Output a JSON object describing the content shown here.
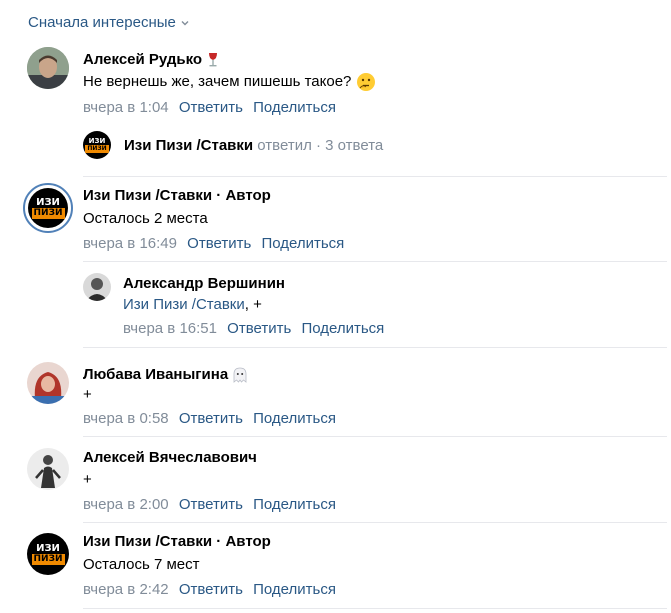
{
  "sort": {
    "label": "Сначала интересные"
  },
  "logo": {
    "line1": "ИЗИ",
    "line2": "ПИЗИ"
  },
  "comments": [
    {
      "name": "Алексей Рудько",
      "text": "Не вернешь же, зачем пишешь такое?",
      "time": "вчера в 1:04",
      "reply": "Ответить",
      "share": "Поделиться",
      "thread": {
        "name": "Изи Пизи /Ставки",
        "replied": "ответил",
        "count": "· 3 ответа"
      }
    },
    {
      "name": "Изи Пизи /Ставки",
      "author": "· Автор",
      "text": "Осталось 2 места",
      "time": "вчера в 16:49",
      "reply": "Ответить",
      "share": "Поделиться"
    },
    {
      "name": "Александр Вершинин",
      "mention": "Изи Пизи /Ставки",
      "text": ", +",
      "time": "вчера в 16:51",
      "reply": "Ответить",
      "share": "Поделиться"
    },
    {
      "name": "Любава Иваныгина",
      "text": "+",
      "time": "вчера в 0:58",
      "reply": "Ответить",
      "share": "Поделиться"
    },
    {
      "name": "Алексей Вячеславович",
      "text": "+",
      "time": "вчера в 2:00",
      "reply": "Ответить",
      "share": "Поделиться"
    },
    {
      "name": "Изи Пизи /Ставки",
      "author": "· Автор",
      "text": "Осталось 7 мест",
      "time": "вчера в 2:42",
      "reply": "Ответить",
      "share": "Поделиться"
    }
  ]
}
